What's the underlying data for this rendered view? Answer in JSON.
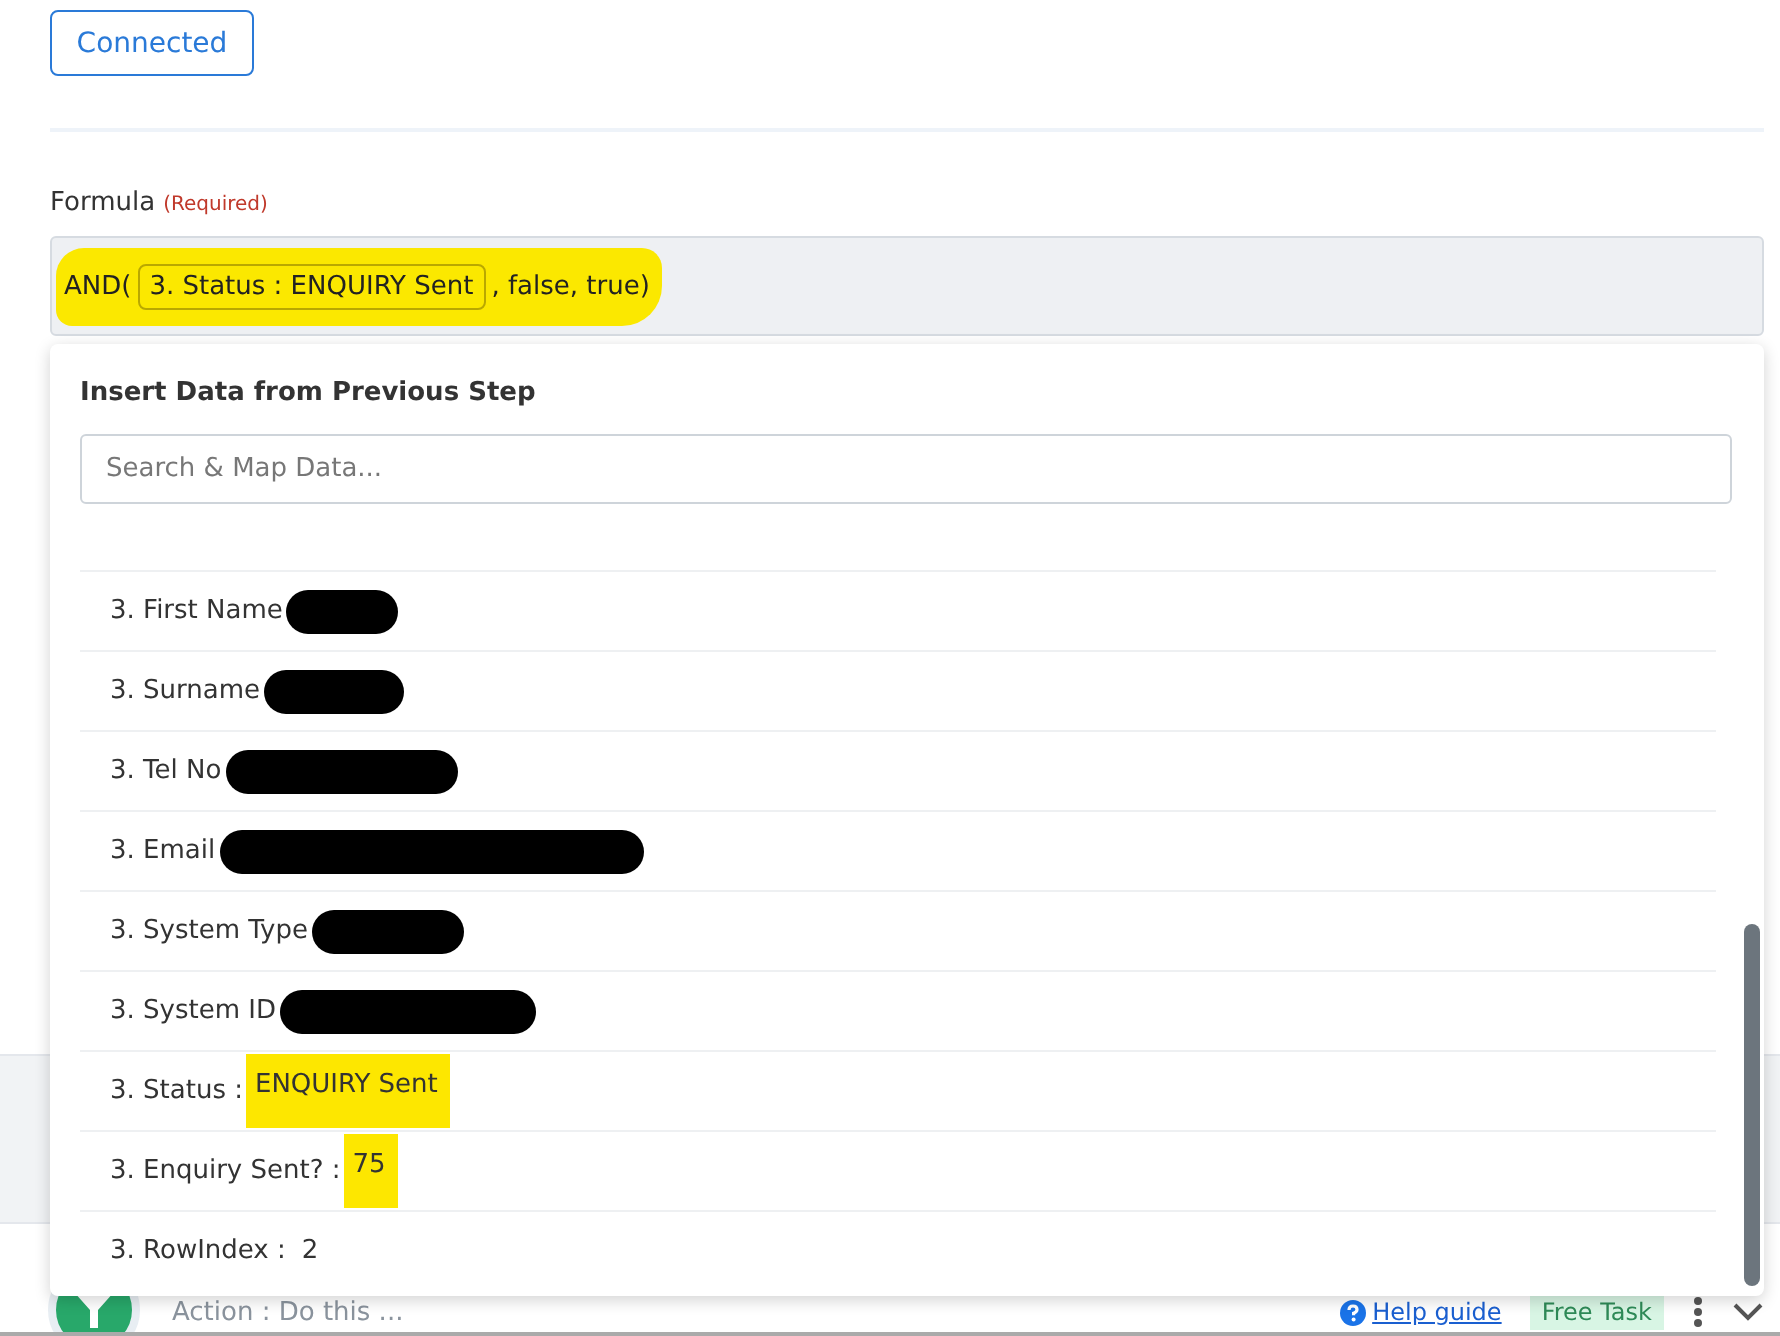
{
  "connection_button": {
    "label": "Connected"
  },
  "formula": {
    "label": "Formula",
    "required_note": "(Required)",
    "prefix": "AND(",
    "token": "3. Status : ENQUIRY Sent",
    "suffix": ", false, true)",
    "highlighted": true
  },
  "dropdown": {
    "title": "Insert Data from Previous Step",
    "search": {
      "placeholder": "Search & Map Data..."
    },
    "items": [
      {
        "label": "3. First Name",
        "redacted": true
      },
      {
        "label": "3. Surname",
        "redacted": true
      },
      {
        "label": "3. Tel No",
        "redacted": true
      },
      {
        "label": "3. Email",
        "redacted": true
      },
      {
        "label": "3. System Type",
        "redacted": true
      },
      {
        "label": "3. System ID",
        "redacted": true
      },
      {
        "label": "3. Status :",
        "value": "ENQUIRY Sent",
        "redacted": false,
        "highlighted": true
      },
      {
        "label": "3. Enquiry Sent? :",
        "value": "75",
        "redacted": false,
        "highlighted": true
      },
      {
        "label": "3. RowIndex :",
        "value": "2",
        "redacted": false,
        "highlighted": false
      }
    ]
  },
  "next_step": {
    "caption": "Action : Do this ..."
  },
  "footer": {
    "help_link": "Help guide",
    "badge": "Free Task"
  }
}
